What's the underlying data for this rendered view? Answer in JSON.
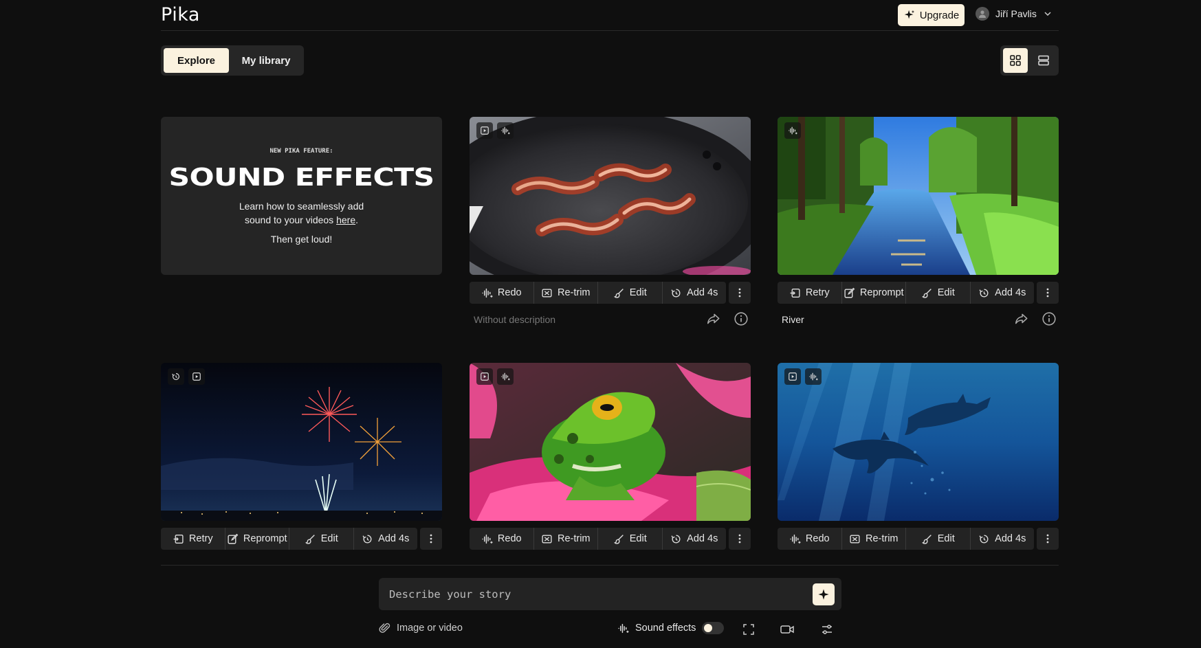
{
  "header": {
    "logo": "Pika",
    "upgrade_label": "Upgrade",
    "user_name": "Jiří Pavlis"
  },
  "tabs": [
    {
      "label": "Explore",
      "active": true
    },
    {
      "label": "My library",
      "active": false
    }
  ],
  "promo": {
    "kicker": "NEW PIKA FEATURE:",
    "title": "SOUND EFFECTS",
    "body_line1": "Learn how to seamlessly add",
    "body_line2_prefix": "sound to your videos ",
    "link_text": "here",
    "body_line2_suffix": ".",
    "tagline": "Then get loud!"
  },
  "cards": [
    {
      "id": "bacon",
      "badges": [
        "play-square-icon",
        "sound-wave-icon"
      ],
      "actions": [
        {
          "label": "Redo",
          "icon": "sound-wave-icon"
        },
        {
          "label": "Re-trim",
          "icon": "trim-icon"
        },
        {
          "label": "Edit",
          "icon": "brush-icon"
        },
        {
          "label": "Add 4s",
          "icon": "timer-icon"
        }
      ],
      "description": "Without description",
      "muted": true
    },
    {
      "id": "river",
      "badges": [
        "sound-wave-icon"
      ],
      "actions": [
        {
          "label": "Retry",
          "icon": "retry-icon"
        },
        {
          "label": "Reprompt",
          "icon": "pencil-icon"
        },
        {
          "label": "Edit",
          "icon": "brush-icon"
        },
        {
          "label": "Add 4s",
          "icon": "timer-icon"
        }
      ],
      "description": "River",
      "muted": false
    },
    {
      "id": "fireworks",
      "badges": [
        "timer-icon",
        "play-square-icon"
      ],
      "actions": [
        {
          "label": "Retry",
          "icon": "retry-icon"
        },
        {
          "label": "Reprompt",
          "icon": "pencil-icon"
        },
        {
          "label": "Edit",
          "icon": "brush-icon"
        },
        {
          "label": "Add 4s",
          "icon": "timer-icon"
        }
      ]
    },
    {
      "id": "frog",
      "badges": [
        "play-square-icon",
        "sound-wave-icon"
      ],
      "actions": [
        {
          "label": "Redo",
          "icon": "sound-wave-icon"
        },
        {
          "label": "Re-trim",
          "icon": "trim-icon"
        },
        {
          "label": "Edit",
          "icon": "brush-icon"
        },
        {
          "label": "Add 4s",
          "icon": "timer-icon"
        }
      ]
    },
    {
      "id": "dolphins",
      "badges": [
        "play-square-icon",
        "sound-wave-icon"
      ],
      "actions": [
        {
          "label": "Redo",
          "icon": "sound-wave-icon"
        },
        {
          "label": "Re-trim",
          "icon": "trim-icon"
        },
        {
          "label": "Edit",
          "icon": "brush-icon"
        },
        {
          "label": "Add 4s",
          "icon": "timer-icon"
        }
      ]
    }
  ],
  "prompt": {
    "placeholder": "Describe your story"
  },
  "bottom_bar": {
    "attach_label": "Image or video",
    "sound_label": "Sound effects",
    "sound_on": false
  },
  "colors": {
    "accent": "#fbf2df",
    "background": "#0f0f0f",
    "surface": "#232323"
  }
}
